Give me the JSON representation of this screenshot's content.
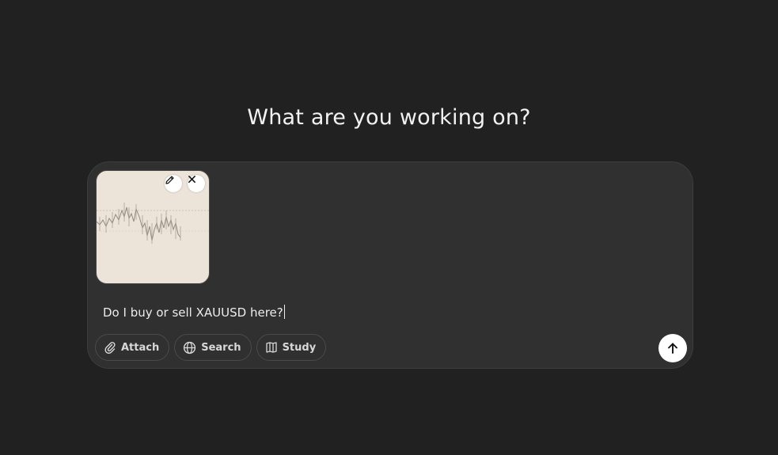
{
  "heading": "What are you working on?",
  "composer": {
    "attachment": {
      "type": "image",
      "edit_icon": "pencil-icon",
      "remove_icon": "close-icon"
    },
    "input_value": "Do I buy or sell XAUUSD here?",
    "tools": [
      {
        "label": "Attach",
        "icon": "paperclip-icon"
      },
      {
        "label": "Search",
        "icon": "globe-icon"
      },
      {
        "label": "Study",
        "icon": "book-icon"
      }
    ],
    "send_icon": "arrow-up-icon"
  },
  "colors": {
    "background": "#212121",
    "composer": "#303030",
    "thumbnail": "#ece4d8",
    "button_white": "#ffffff"
  }
}
